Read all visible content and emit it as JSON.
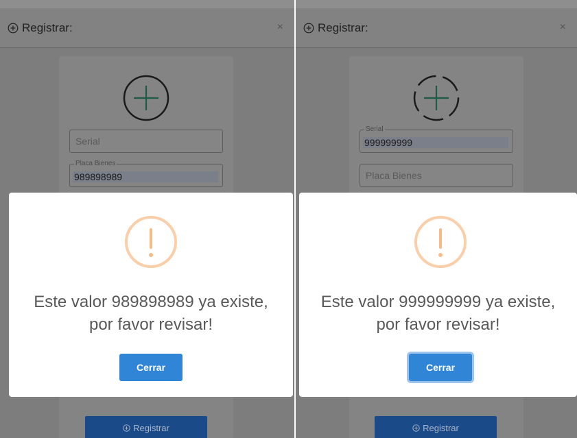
{
  "panels": [
    {
      "modal": {
        "title": "Registrar:",
        "close": "×",
        "serial_field": {
          "placeholder": "Serial",
          "legend": "",
          "value": ""
        },
        "placa_field": {
          "placeholder": "",
          "legend": "Placa Bienes",
          "value": "989898989"
        },
        "submit_label": "Registrar"
      },
      "alert": {
        "line1": "Este valor 989898989 ya existe,",
        "line2": "por favor revisar!",
        "button": "Cerrar"
      }
    },
    {
      "modal": {
        "title": "Registrar:",
        "close": "×",
        "serial_field": {
          "placeholder": "",
          "legend": "Serial",
          "value": "999999999"
        },
        "placa_field": {
          "placeholder": "Placa Bienes",
          "legend": "",
          "value": ""
        },
        "submit_label": "Registrar"
      },
      "alert": {
        "line1": "Este valor 999999999 ya existe,",
        "line2": "por favor revisar!",
        "button": "Cerrar"
      }
    }
  ],
  "colors": {
    "confirm_button": "#3085d6",
    "warning_icon": "#f8bb86",
    "register_button": "#2a6fd0",
    "plus_icon": "#2f9e77"
  }
}
